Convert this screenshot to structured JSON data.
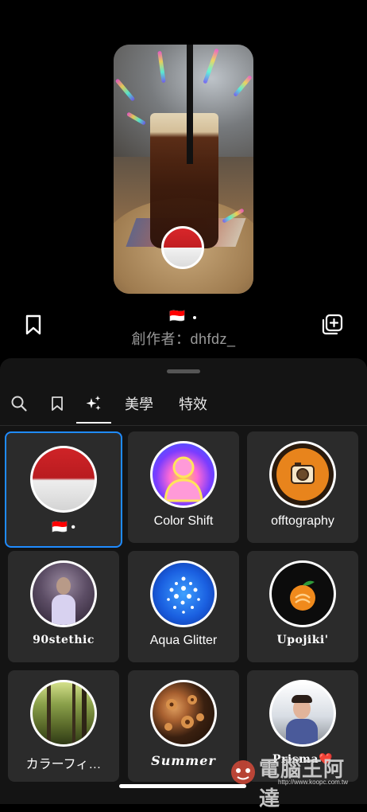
{
  "preview": {
    "effect_flag": "🇮🇩",
    "creator_text": "創作者：dhfdz_"
  },
  "tabs": {
    "items": [
      {
        "name": "search",
        "icon": "search-icon"
      },
      {
        "name": "saved",
        "icon": "bookmark-icon"
      },
      {
        "name": "trending",
        "icon": "sparkles-icon",
        "selected": true
      },
      {
        "name": "aesthetics",
        "label": "美學"
      },
      {
        "name": "effects",
        "label": "特效"
      }
    ]
  },
  "effects": [
    {
      "label": "🇮🇩 •",
      "selected": true,
      "style": "flag"
    },
    {
      "label": "Color Shift",
      "style": "colorshift"
    },
    {
      "label": "offtography",
      "style": "camera"
    },
    {
      "label": "90stethic",
      "style": "portrait"
    },
    {
      "label": "Aqua Glitter",
      "style": "aqua"
    },
    {
      "label": "Upojiki'",
      "style": "orange"
    },
    {
      "label": "カラーフィ…",
      "style": "forest"
    },
    {
      "label": "Summer",
      "style": "flowers"
    },
    {
      "label": "Prisma❤️",
      "style": "boy"
    }
  ],
  "watermark": {
    "text": "電腦王阿達",
    "url": "http://www.koopc.com.tw"
  },
  "colors": {
    "selection": "#1f8bff",
    "sheet_bg": "#141414",
    "card_bg": "#2b2b2b"
  }
}
